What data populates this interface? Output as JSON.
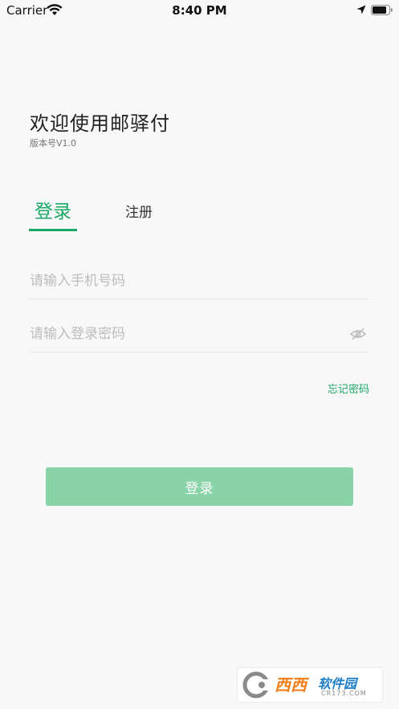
{
  "status_bar": {
    "carrier": "Carrier",
    "time": "8:40 PM",
    "icons": [
      "wifi-icon",
      "location-icon",
      "battery-icon"
    ]
  },
  "header": {
    "title": "欢迎使用邮驿付",
    "version": "版本号V1.0"
  },
  "tabs": {
    "login_label": "登录",
    "register_label": "注册",
    "active": "login"
  },
  "form": {
    "phone_placeholder": "请输入手机号码",
    "phone_value": "",
    "password_placeholder": "请输入登录密码",
    "password_value": "",
    "password_toggle_icon": "eye-icon",
    "forgot_label": "忘记密码"
  },
  "login_button": {
    "label": "登录"
  },
  "watermark": {
    "brand": "西西",
    "name": "软件园",
    "domain": "CR173.COM"
  },
  "colors": {
    "accent": "#1aa865",
    "button_bg": "#8ad3a8",
    "background": "#f8f8f8",
    "placeholder": "#bdbdbd"
  }
}
